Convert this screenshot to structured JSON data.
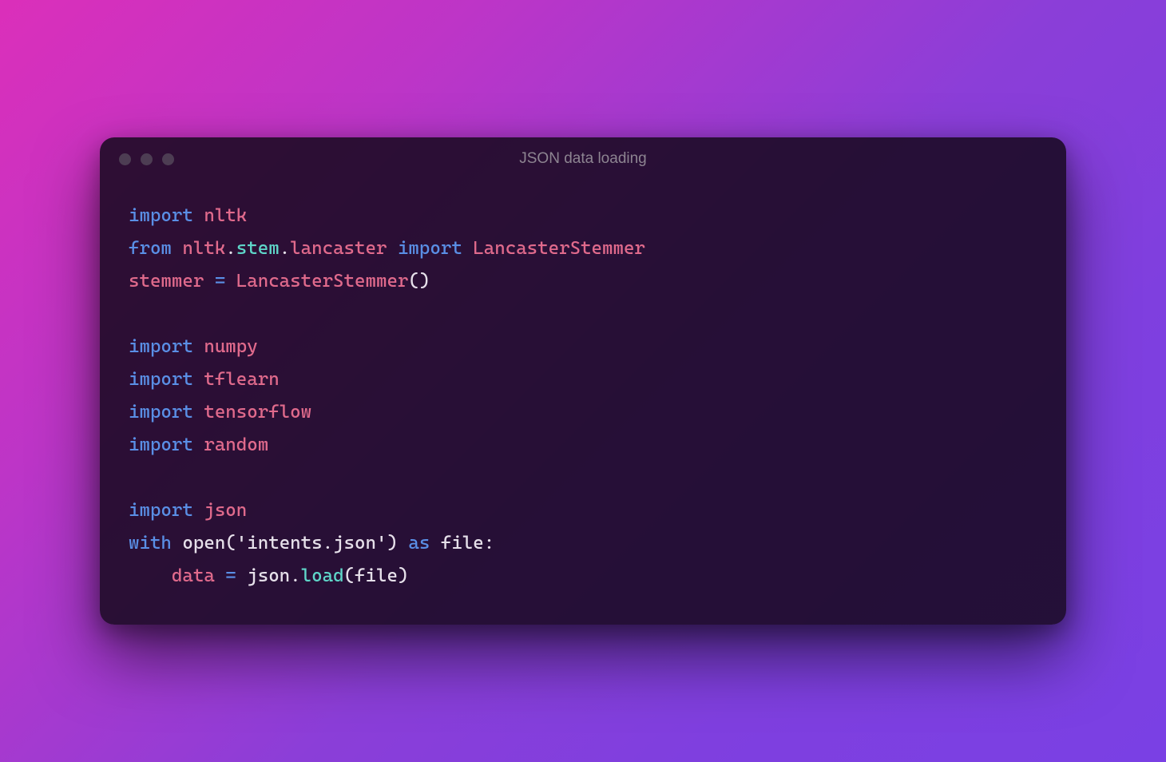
{
  "window": {
    "title": "JSON data loading"
  },
  "code": {
    "tokens": [
      [
        {
          "t": "import ",
          "c": "keyword"
        },
        {
          "t": "nltk",
          "c": "module"
        }
      ],
      [
        {
          "t": "from ",
          "c": "keyword"
        },
        {
          "t": "nltk",
          "c": "module"
        },
        {
          "t": ".",
          "c": "punct"
        },
        {
          "t": "stem",
          "c": "class"
        },
        {
          "t": ".",
          "c": "punct"
        },
        {
          "t": "lancaster ",
          "c": "module"
        },
        {
          "t": "import ",
          "c": "keyword"
        },
        {
          "t": "LancasterStemmer",
          "c": "module"
        }
      ],
      [
        {
          "t": "stemmer ",
          "c": "var"
        },
        {
          "t": "= ",
          "c": "op"
        },
        {
          "t": "LancasterStemmer",
          "c": "module"
        },
        {
          "t": "()",
          "c": "punct"
        }
      ],
      [
        {
          "t": "",
          "c": "plain"
        }
      ],
      [
        {
          "t": "import ",
          "c": "keyword"
        },
        {
          "t": "numpy",
          "c": "module"
        }
      ],
      [
        {
          "t": "import ",
          "c": "keyword"
        },
        {
          "t": "tflearn",
          "c": "module"
        }
      ],
      [
        {
          "t": "import ",
          "c": "keyword"
        },
        {
          "t": "tensorflow",
          "c": "module"
        }
      ],
      [
        {
          "t": "import ",
          "c": "keyword"
        },
        {
          "t": "random",
          "c": "module"
        }
      ],
      [
        {
          "t": "",
          "c": "plain"
        }
      ],
      [
        {
          "t": "import ",
          "c": "keyword"
        },
        {
          "t": "json",
          "c": "module"
        }
      ],
      [
        {
          "t": "with ",
          "c": "keyword"
        },
        {
          "t": "open",
          "c": "plain"
        },
        {
          "t": "(",
          "c": "punct"
        },
        {
          "t": "'intents.json'",
          "c": "string"
        },
        {
          "t": ") ",
          "c": "punct"
        },
        {
          "t": "as ",
          "c": "keyword"
        },
        {
          "t": "file",
          "c": "plain"
        },
        {
          "t": ":",
          "c": "punct"
        }
      ],
      [
        {
          "t": "    ",
          "c": "plain"
        },
        {
          "t": "data ",
          "c": "var"
        },
        {
          "t": "= ",
          "c": "op"
        },
        {
          "t": "json",
          "c": "plain"
        },
        {
          "t": ".",
          "c": "punct"
        },
        {
          "t": "load",
          "c": "func"
        },
        {
          "t": "(",
          "c": "punct"
        },
        {
          "t": "file",
          "c": "plain"
        },
        {
          "t": ")",
          "c": "punct"
        }
      ]
    ]
  }
}
